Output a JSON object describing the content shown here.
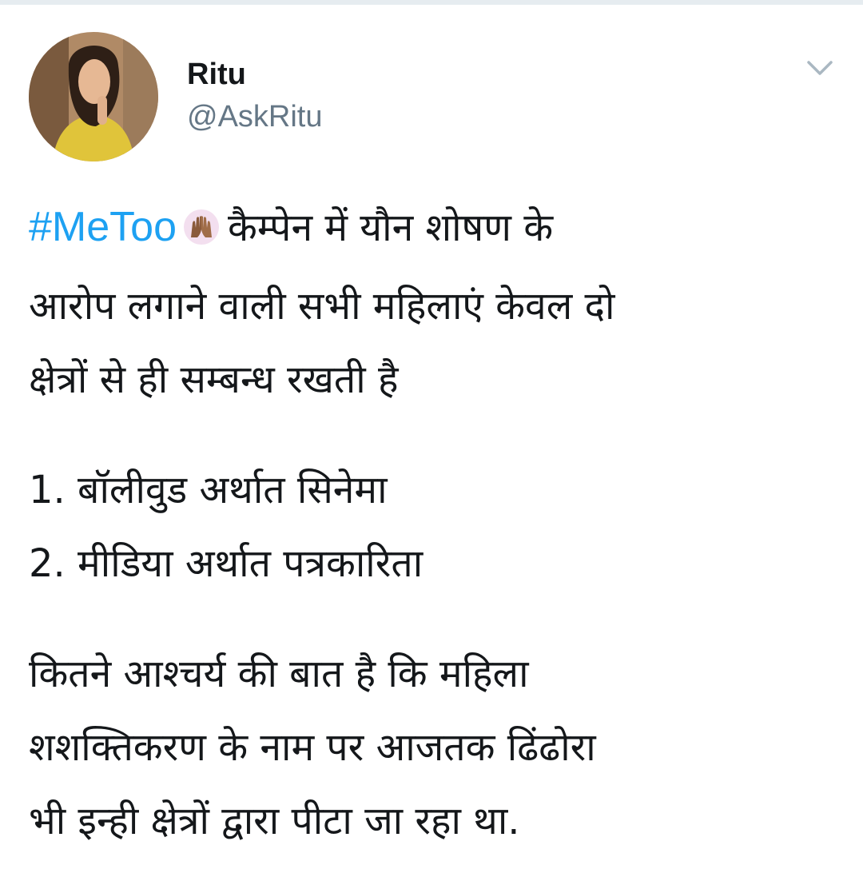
{
  "tweet": {
    "author": {
      "name": "Ritu",
      "handle": "@AskRitu"
    },
    "hashtag": "#MeToo",
    "emoji": "raised-hands-icon",
    "text_lines": {
      "l1": "कैम्पेन में यौन शोषण के",
      "l2": "आरोप लगाने वाली सभी महिलाएं केवल दो",
      "l3": "क्षेत्रों से ही सम्बन्ध रखती है",
      "l4": "1. बॉलीवुड अर्थात सिनेमा",
      "l5": "2. मीडिया अर्थात पत्रकारिता",
      "l6": "कितने आश्चर्य की बात है कि महिला",
      "l7": "शशक्तिकरण के नाम पर आजतक ढिंढोरा",
      "l8": "भी इन्ही क्षेत्रों द्वारा पीटा जा रहा था."
    }
  },
  "colors": {
    "hashtag": "#1da1f2",
    "text": "#14171a",
    "secondary": "#657786",
    "caret": "#aab8c2"
  }
}
